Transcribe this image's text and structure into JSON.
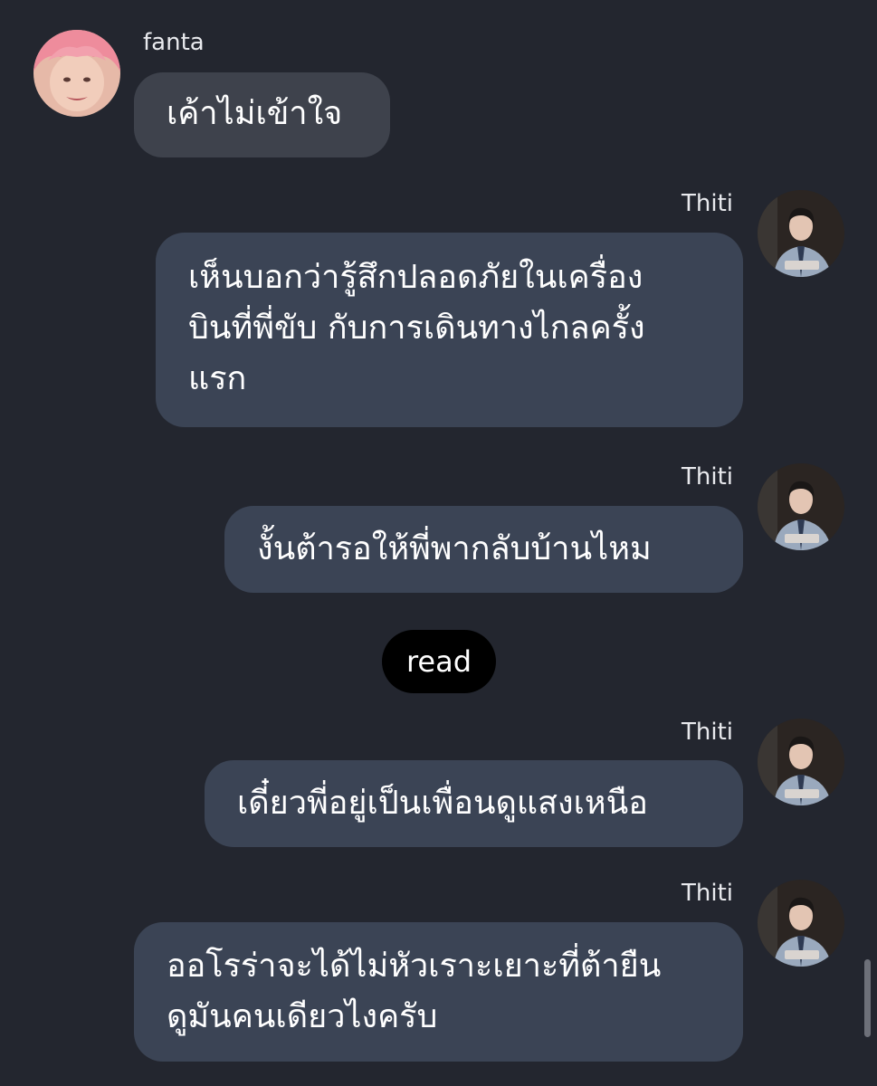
{
  "messages": [
    {
      "sender": "fanta",
      "text": "เค้าไม่เข้าใจ"
    },
    {
      "sender": "Thiti",
      "text": "เห็นบอกว่ารู้สึกปลอดภัยในเครื่อง\nบินที่พี่ขับ กับการเดินทางไกลครั้ง\nแรก"
    },
    {
      "sender": "Thiti",
      "text": "งั้นต้ารอให้พี่พากลับบ้านไหม"
    },
    {
      "sender": "Thiti",
      "text": "เดี๋ยวพี่อยู่เป็นเพื่อนดูแสงเหนือ"
    },
    {
      "sender": "Thiti",
      "text": "ออโรร่าจะได้ไม่หัวเราะเยาะที่ต้ายืน\nดูมันคนเดียวไงครับ"
    }
  ],
  "status": {
    "read_label": "read"
  },
  "colors": {
    "background": "#23262f",
    "incoming_bubble": "#3e424c",
    "outgoing_bubble": "#3b4455",
    "read_pill": "#000000"
  },
  "icons": {
    "fanta_avatar": "avatar-photo-pink-hair",
    "thiti_avatar": "avatar-photo-uniform"
  }
}
